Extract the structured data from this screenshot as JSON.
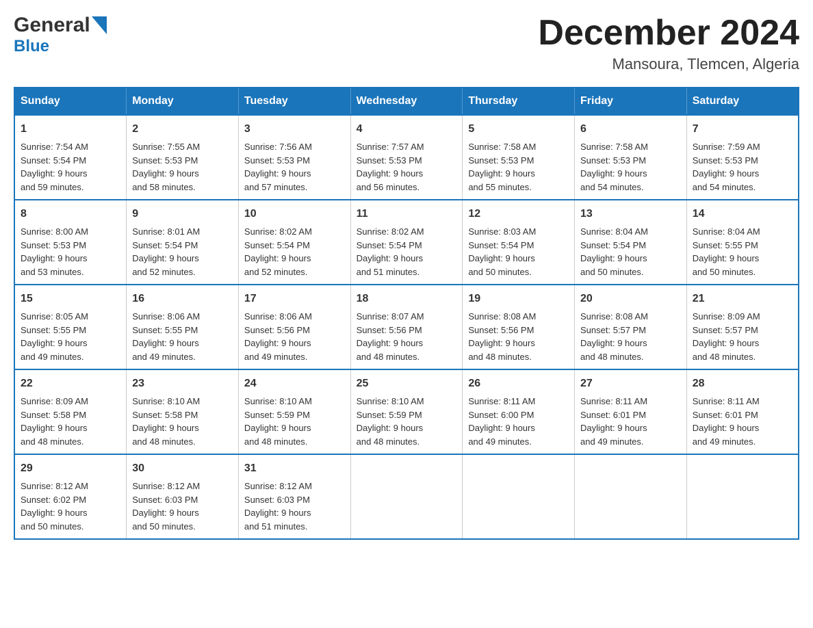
{
  "logo": {
    "general": "General",
    "blue": "Blue",
    "triangle_color": "#1a75bb"
  },
  "title": {
    "month_year": "December 2024",
    "location": "Mansoura, Tlemcen, Algeria"
  },
  "weekdays": [
    "Sunday",
    "Monday",
    "Tuesday",
    "Wednesday",
    "Thursday",
    "Friday",
    "Saturday"
  ],
  "weeks": [
    [
      {
        "day": "1",
        "sunrise": "7:54 AM",
        "sunset": "5:54 PM",
        "daylight": "9 hours and 59 minutes."
      },
      {
        "day": "2",
        "sunrise": "7:55 AM",
        "sunset": "5:53 PM",
        "daylight": "9 hours and 58 minutes."
      },
      {
        "day": "3",
        "sunrise": "7:56 AM",
        "sunset": "5:53 PM",
        "daylight": "9 hours and 57 minutes."
      },
      {
        "day": "4",
        "sunrise": "7:57 AM",
        "sunset": "5:53 PM",
        "daylight": "9 hours and 56 minutes."
      },
      {
        "day": "5",
        "sunrise": "7:58 AM",
        "sunset": "5:53 PM",
        "daylight": "9 hours and 55 minutes."
      },
      {
        "day": "6",
        "sunrise": "7:58 AM",
        "sunset": "5:53 PM",
        "daylight": "9 hours and 54 minutes."
      },
      {
        "day": "7",
        "sunrise": "7:59 AM",
        "sunset": "5:53 PM",
        "daylight": "9 hours and 54 minutes."
      }
    ],
    [
      {
        "day": "8",
        "sunrise": "8:00 AM",
        "sunset": "5:53 PM",
        "daylight": "9 hours and 53 minutes."
      },
      {
        "day": "9",
        "sunrise": "8:01 AM",
        "sunset": "5:54 PM",
        "daylight": "9 hours and 52 minutes."
      },
      {
        "day": "10",
        "sunrise": "8:02 AM",
        "sunset": "5:54 PM",
        "daylight": "9 hours and 52 minutes."
      },
      {
        "day": "11",
        "sunrise": "8:02 AM",
        "sunset": "5:54 PM",
        "daylight": "9 hours and 51 minutes."
      },
      {
        "day": "12",
        "sunrise": "8:03 AM",
        "sunset": "5:54 PM",
        "daylight": "9 hours and 50 minutes."
      },
      {
        "day": "13",
        "sunrise": "8:04 AM",
        "sunset": "5:54 PM",
        "daylight": "9 hours and 50 minutes."
      },
      {
        "day": "14",
        "sunrise": "8:04 AM",
        "sunset": "5:55 PM",
        "daylight": "9 hours and 50 minutes."
      }
    ],
    [
      {
        "day": "15",
        "sunrise": "8:05 AM",
        "sunset": "5:55 PM",
        "daylight": "9 hours and 49 minutes."
      },
      {
        "day": "16",
        "sunrise": "8:06 AM",
        "sunset": "5:55 PM",
        "daylight": "9 hours and 49 minutes."
      },
      {
        "day": "17",
        "sunrise": "8:06 AM",
        "sunset": "5:56 PM",
        "daylight": "9 hours and 49 minutes."
      },
      {
        "day": "18",
        "sunrise": "8:07 AM",
        "sunset": "5:56 PM",
        "daylight": "9 hours and 48 minutes."
      },
      {
        "day": "19",
        "sunrise": "8:08 AM",
        "sunset": "5:56 PM",
        "daylight": "9 hours and 48 minutes."
      },
      {
        "day": "20",
        "sunrise": "8:08 AM",
        "sunset": "5:57 PM",
        "daylight": "9 hours and 48 minutes."
      },
      {
        "day": "21",
        "sunrise": "8:09 AM",
        "sunset": "5:57 PM",
        "daylight": "9 hours and 48 minutes."
      }
    ],
    [
      {
        "day": "22",
        "sunrise": "8:09 AM",
        "sunset": "5:58 PM",
        "daylight": "9 hours and 48 minutes."
      },
      {
        "day": "23",
        "sunrise": "8:10 AM",
        "sunset": "5:58 PM",
        "daylight": "9 hours and 48 minutes."
      },
      {
        "day": "24",
        "sunrise": "8:10 AM",
        "sunset": "5:59 PM",
        "daylight": "9 hours and 48 minutes."
      },
      {
        "day": "25",
        "sunrise": "8:10 AM",
        "sunset": "5:59 PM",
        "daylight": "9 hours and 48 minutes."
      },
      {
        "day": "26",
        "sunrise": "8:11 AM",
        "sunset": "6:00 PM",
        "daylight": "9 hours and 49 minutes."
      },
      {
        "day": "27",
        "sunrise": "8:11 AM",
        "sunset": "6:01 PM",
        "daylight": "9 hours and 49 minutes."
      },
      {
        "day": "28",
        "sunrise": "8:11 AM",
        "sunset": "6:01 PM",
        "daylight": "9 hours and 49 minutes."
      }
    ],
    [
      {
        "day": "29",
        "sunrise": "8:12 AM",
        "sunset": "6:02 PM",
        "daylight": "9 hours and 50 minutes."
      },
      {
        "day": "30",
        "sunrise": "8:12 AM",
        "sunset": "6:03 PM",
        "daylight": "9 hours and 50 minutes."
      },
      {
        "day": "31",
        "sunrise": "8:12 AM",
        "sunset": "6:03 PM",
        "daylight": "9 hours and 51 minutes."
      },
      null,
      null,
      null,
      null
    ]
  ],
  "labels": {
    "sunrise": "Sunrise:",
    "sunset": "Sunset:",
    "daylight": "Daylight:"
  },
  "colors": {
    "header_bg": "#1a75bb",
    "header_text": "#ffffff",
    "border": "#1a75bb",
    "cell_border": "#cccccc"
  }
}
